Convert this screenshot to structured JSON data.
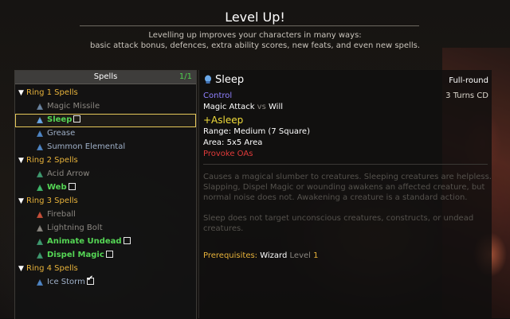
{
  "header": {
    "title": "Level Up!",
    "subtitle_line1": "Levelling up improves your characters in many ways:",
    "subtitle_line2": "basic attack bonus, defences, extra ability scores, new feats, and even new spells."
  },
  "spells_panel": {
    "title": "Spells",
    "count": "1/1",
    "rings": [
      {
        "label": "Ring 1 Spells",
        "spells": [
          {
            "name": "Magic Missile",
            "icon": "magic-missile-icon",
            "state": "unavailable"
          },
          {
            "name": "Sleep",
            "icon": "sleep-icon",
            "state": "selectable",
            "checked": false,
            "selected": true
          },
          {
            "name": "Grease",
            "icon": "grease-icon",
            "state": "known"
          },
          {
            "name": "Summon Elemental",
            "icon": "summon-elemental-icon",
            "state": "known"
          }
        ]
      },
      {
        "label": "Ring 2 Spells",
        "spells": [
          {
            "name": "Acid Arrow",
            "icon": "acid-arrow-icon",
            "state": "unavailable"
          },
          {
            "name": "Web",
            "icon": "web-icon",
            "state": "selectable",
            "checked": false
          }
        ]
      },
      {
        "label": "Ring 3 Spells",
        "spells": [
          {
            "name": "Fireball",
            "icon": "fireball-icon",
            "state": "unavailable"
          },
          {
            "name": "Lightning Bolt",
            "icon": "lightning-bolt-icon",
            "state": "unavailable"
          },
          {
            "name": "Animate Undead",
            "icon": "animate-undead-icon",
            "state": "selectable",
            "checked": false
          },
          {
            "name": "Dispel Magic",
            "icon": "dispel-magic-icon",
            "state": "selectable",
            "checked": false
          }
        ]
      },
      {
        "label": "Ring 4 Spells",
        "spells": [
          {
            "name": "Ice Storm",
            "icon": "ice-storm-icon",
            "state": "known",
            "checked": true
          }
        ]
      }
    ]
  },
  "detail": {
    "name": "Sleep",
    "casting_time": "Full-round",
    "school": "Control",
    "duration": "3 Turns CD",
    "attack": "Magic Attack",
    "vs": "vs",
    "defence": "Will",
    "effect": "+Asleep",
    "range_label": "Range:",
    "range_value": "Medium (7 Square)",
    "area_label": "Area:",
    "area_value": "5x5 Area",
    "provoke": "Provoke OAs",
    "description_1": "Causes a magical slumber to creatures. Sleeping creatures are helpless. Slapping, Dispel Magic or wounding awakens an affected creature, but normal noise does not. Awakening a creature is a standard action.",
    "description_2": "Sleep does not target unconscious creatures, constructs, or undead creatures.",
    "prereq_label": "Prerequisites:",
    "prereq_class": "Wizard",
    "prereq_level_label": "Level",
    "prereq_level": "1"
  },
  "colors": {
    "ring_header": "#e7b23a",
    "selectable": "#55d655",
    "school": "#8f80ff",
    "effect": "#f2de3a",
    "provoke": "#e03a3a",
    "selection_outline": "#e6c85a"
  }
}
